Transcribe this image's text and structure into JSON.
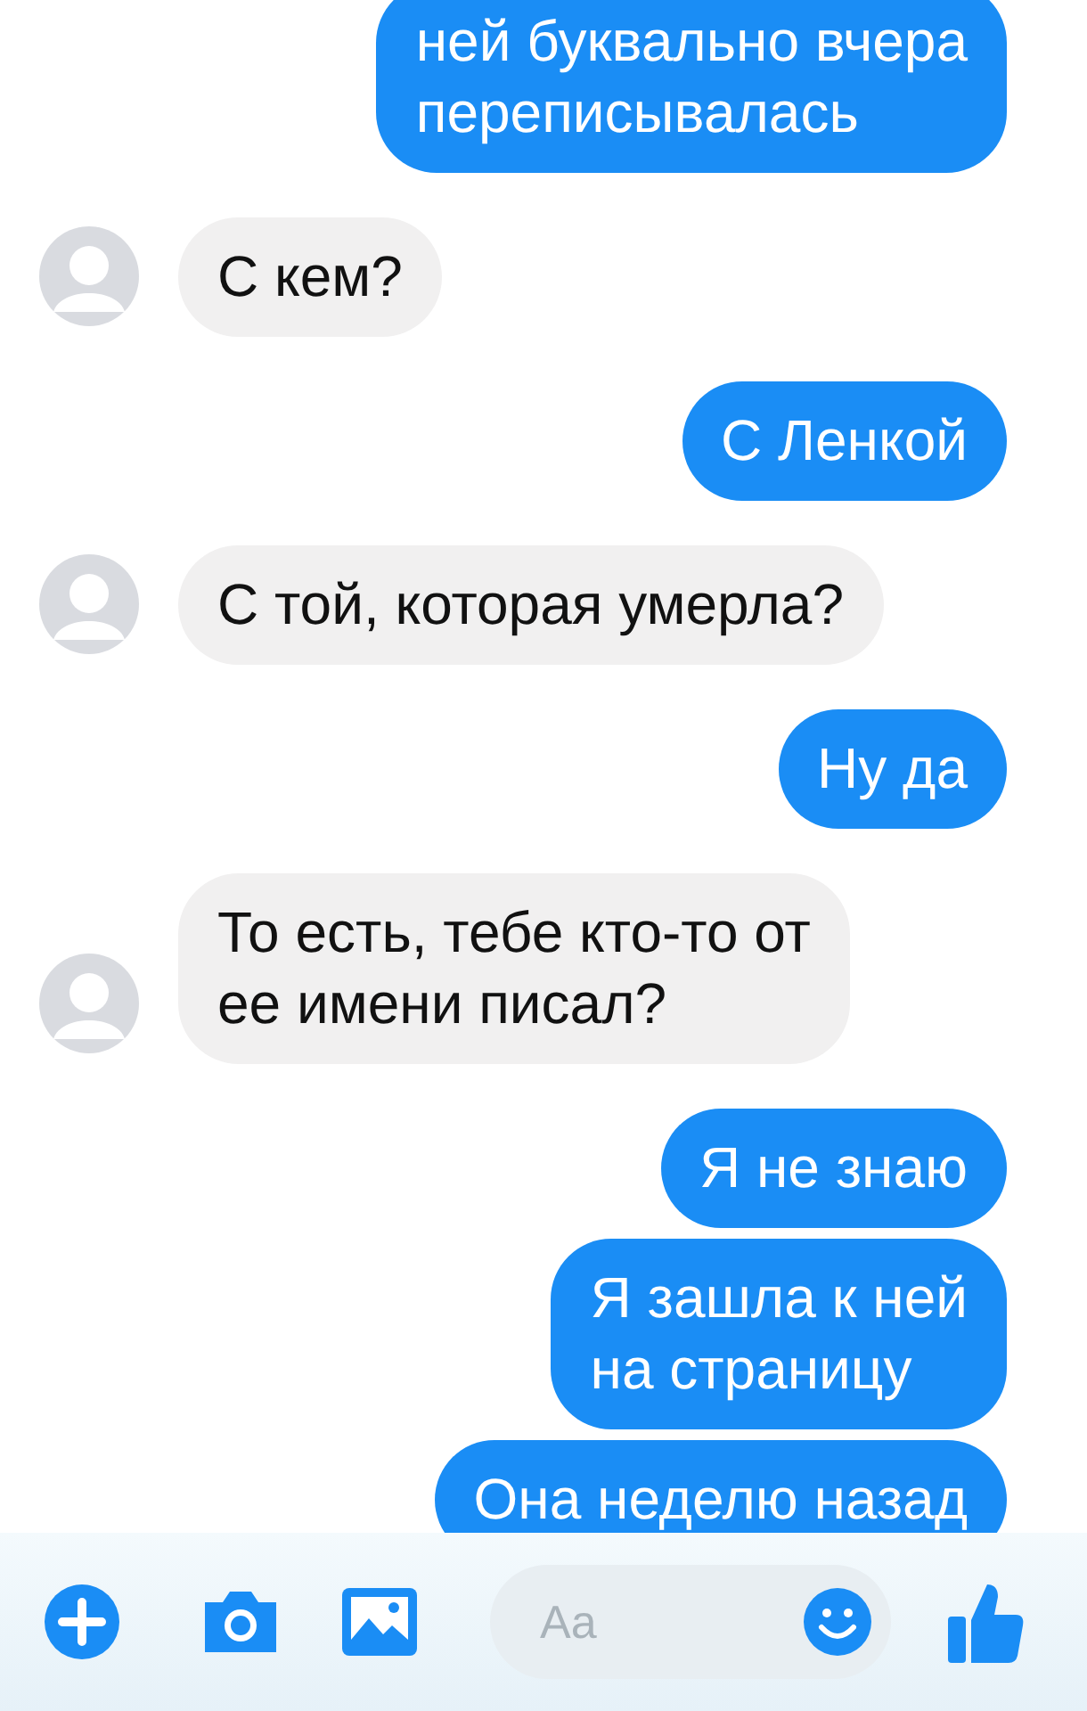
{
  "messages": [
    {
      "kind": "sent",
      "text": "ней буквально вчера\nпереписывалась"
    },
    {
      "kind": "received",
      "text": "С кем?"
    },
    {
      "kind": "sent",
      "text": "С Ленкой"
    },
    {
      "kind": "received",
      "text": "С той, которая умерла?"
    },
    {
      "kind": "sent",
      "text": "Ну да"
    },
    {
      "kind": "received",
      "text": "То есть, тебе кто-то от\nее имени писал?"
    },
    {
      "kind": "sent",
      "text": "Я не знаю"
    },
    {
      "kind": "sent",
      "text": "Я зашла к ней\nна страницу"
    },
    {
      "kind": "sent",
      "text": "Она неделю назад"
    }
  ],
  "composer": {
    "placeholder": "Aa"
  }
}
